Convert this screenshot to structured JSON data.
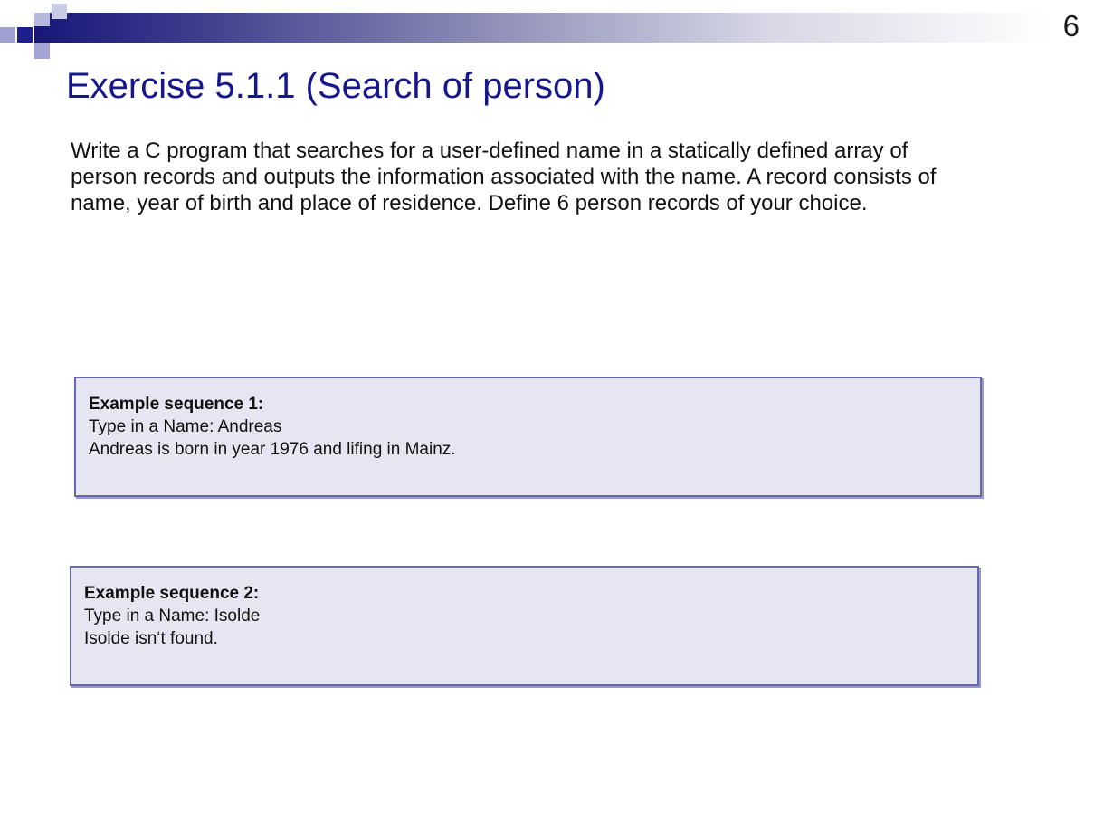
{
  "slide": {
    "number": "6",
    "title": "Exercise 5.1.1 (Search of person)",
    "description": "Write a C program that searches for a user-defined name in a statically defined array of person records and outputs the information associated with the name. A record consists of name, year of birth and place of residence. Define 6 person records of your choice."
  },
  "examples": [
    {
      "heading": "Example sequence 1:",
      "lines": [
        "Type in a Name: Andreas",
        "Andreas is born in year 1976 and lifing in Mainz."
      ]
    },
    {
      "heading": "Example sequence 2:",
      "lines": [
        "Type in a Name: Isolde",
        "Isolde isn‘t found."
      ]
    }
  ],
  "colors": {
    "title": "#17178c",
    "header_dark": "#17177a",
    "box_fill": "#e6e6f2",
    "box_border": "#6667ad"
  }
}
